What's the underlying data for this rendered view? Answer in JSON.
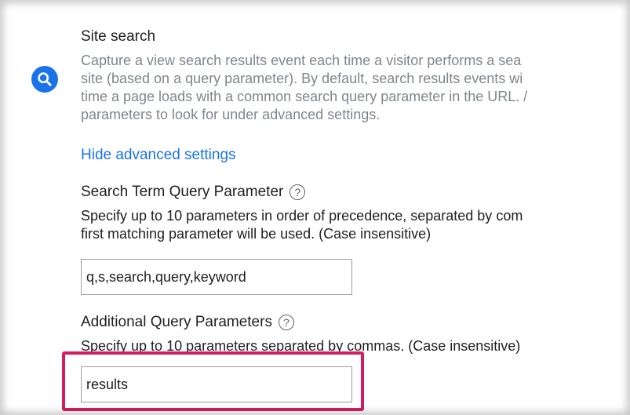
{
  "site_search": {
    "title": "Site search",
    "description_lines": [
      "Capture a view search results event each time a visitor performs a sea",
      "site (based on a query parameter). By default, search results events wi",
      "time a page loads with a common search query parameter in the URL. /",
      "parameters to look for under advanced settings."
    ],
    "hide_advanced_link": "Hide advanced settings",
    "icon": "search-icon",
    "accent_color": "#1a73e8"
  },
  "search_term": {
    "label": "Search Term Query Parameter",
    "help_icon": "help-icon",
    "description_lines": [
      "Specify up to 10 parameters in order of precedence, separated by com",
      "first matching parameter will be used. (Case insensitive)"
    ],
    "value": "q,s,search,query,keyword"
  },
  "additional_params": {
    "label": "Additional Query Parameters",
    "help_icon": "help-icon",
    "description": "Specify up to 10 parameters separated by commas. (Case insensitive)",
    "value": "results"
  },
  "highlight_color": "#d81b60"
}
